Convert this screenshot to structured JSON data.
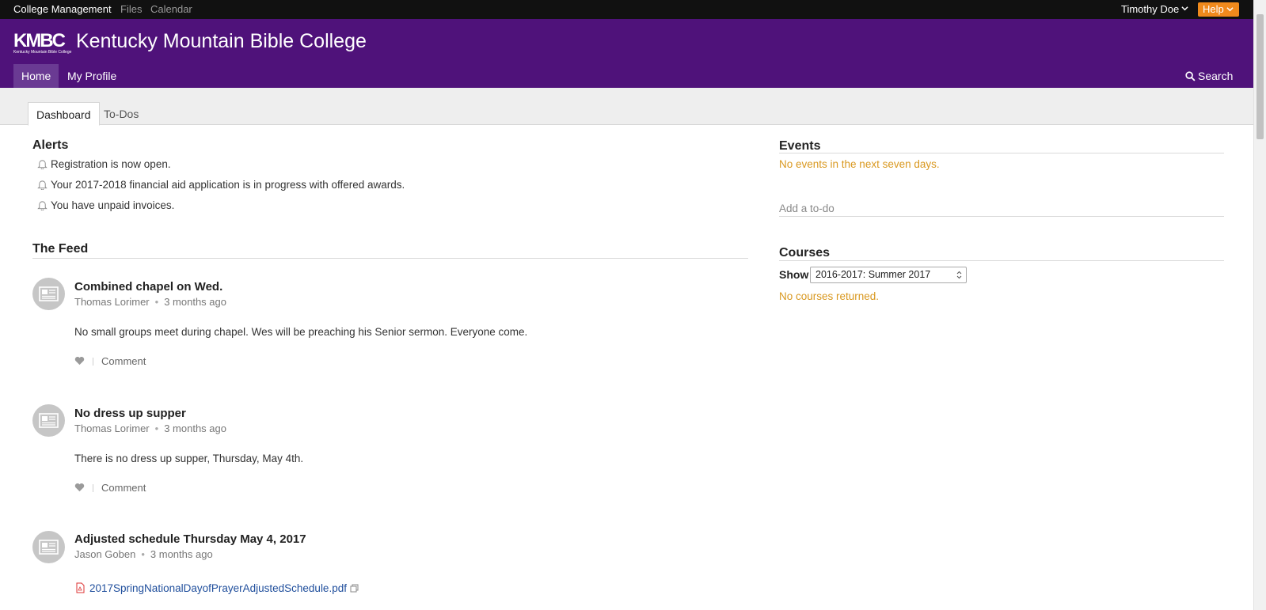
{
  "topbar": {
    "links": [
      "College Management",
      "Files",
      "Calendar"
    ],
    "user_name": "Timothy Doe",
    "help_label": "Help"
  },
  "brand": {
    "logo_mark": "KMBC",
    "logo_sub": "Kentucky Mountain Bible College",
    "title": "Kentucky Mountain Bible College",
    "nav": [
      "Home",
      "My Profile"
    ],
    "search_label": "Search",
    "colors": {
      "header": "#4f127a",
      "help": "#f08a1c",
      "notice": "#d9981f"
    }
  },
  "tabs": [
    "Dashboard",
    "To-Dos"
  ],
  "alerts": {
    "heading": "Alerts",
    "items": [
      "Registration is now open.",
      "Your 2017-2018 financial aid application is in progress with offered awards.",
      "You have unpaid invoices."
    ]
  },
  "feed": {
    "heading": "The Feed",
    "posts": [
      {
        "title": "Combined chapel on Wed.",
        "author": "Thomas Lorimer",
        "time": "3 months ago",
        "body": "No small groups meet during chapel.  Wes will be preaching his Senior sermon.  Everyone come.",
        "comment_label": "Comment"
      },
      {
        "title": "No dress up supper",
        "author": "Thomas Lorimer",
        "time": "3 months ago",
        "body": "There is no dress up supper, Thursday, May 4th.",
        "comment_label": "Comment"
      },
      {
        "title": "Adjusted schedule Thursday May 4, 2017",
        "author": "Jason Goben",
        "time": "3 months ago",
        "attachment": "2017SpringNationalDayofPrayerAdjustedSchedule.pdf"
      }
    ]
  },
  "events": {
    "heading": "Events",
    "empty_text": "No events in the next seven days."
  },
  "todo": {
    "placeholder": "Add a to-do"
  },
  "courses": {
    "heading": "Courses",
    "show_label": "Show",
    "selected_term": "2016-2017: Summer 2017",
    "empty_text": "No courses returned."
  }
}
